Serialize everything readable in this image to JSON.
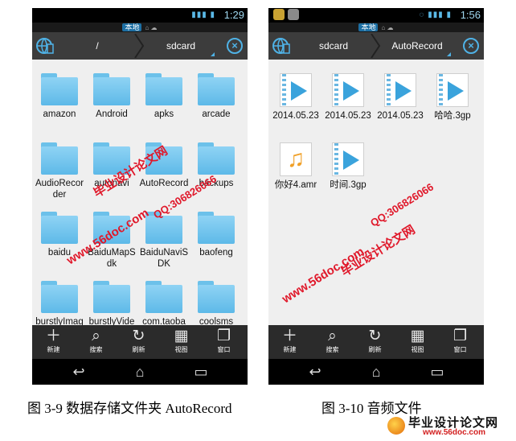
{
  "left_phone": {
    "status": {
      "time": "1:29"
    },
    "location": {
      "label": "本地"
    },
    "path": {
      "crumbs": [
        "/",
        "sdcard"
      ]
    },
    "items": [
      {
        "label": "amazon",
        "type": "folder"
      },
      {
        "label": "Android",
        "type": "folder"
      },
      {
        "label": "apks",
        "type": "folder"
      },
      {
        "label": "arcade",
        "type": "folder"
      },
      {
        "label": "AudioRecorder",
        "type": "folder"
      },
      {
        "label": "autonavi",
        "type": "folder"
      },
      {
        "label": "AutoRecord",
        "type": "folder"
      },
      {
        "label": "backups",
        "type": "folder"
      },
      {
        "label": "baidu",
        "type": "folder"
      },
      {
        "label": "BaiduMapSdk",
        "type": "folder"
      },
      {
        "label": "BaiduNaviSDK",
        "type": "folder"
      },
      {
        "label": "baofeng",
        "type": "folder"
      },
      {
        "label": "burstlyImageCache",
        "type": "folder"
      },
      {
        "label": "burstlyVideoCache",
        "type": "folder"
      },
      {
        "label": "com.taobao.taobao",
        "type": "folder"
      },
      {
        "label": "coolsms",
        "type": "folder"
      }
    ],
    "toolbar": [
      "新建",
      "搜索",
      "刷新",
      "视图",
      "窗口"
    ]
  },
  "right_phone": {
    "status": {
      "time": "1:56"
    },
    "location": {
      "label": "本地"
    },
    "path": {
      "crumbs": [
        "sdcard",
        "AutoRecord"
      ]
    },
    "items": [
      {
        "label": "2014.05.23",
        "type": "video"
      },
      {
        "label": "2014.05.23",
        "type": "video"
      },
      {
        "label": "2014.05.23",
        "type": "video"
      },
      {
        "label": "哈哈.3gp",
        "type": "video"
      },
      {
        "label": "你好4.amr",
        "type": "audio"
      },
      {
        "label": "时间.3gp",
        "type": "video"
      }
    ],
    "toolbar": [
      "新建",
      "搜索",
      "刷新",
      "视图",
      "窗口"
    ]
  },
  "captions": {
    "left": "图 3-9 数据存储文件夹 AutoRecord",
    "right": "图 3-10 音频文件"
  },
  "watermarks": {
    "site_name": "毕业设计论文网",
    "site_url": "www.56doc.com",
    "qq": "QQ:306826066"
  },
  "brand": {
    "name": "毕业设计论文网",
    "url": "www.56doc.com"
  },
  "colors": {
    "folder": "#6cc1ea",
    "accent": "#4fb2e6",
    "watermark": "#e0182a"
  }
}
